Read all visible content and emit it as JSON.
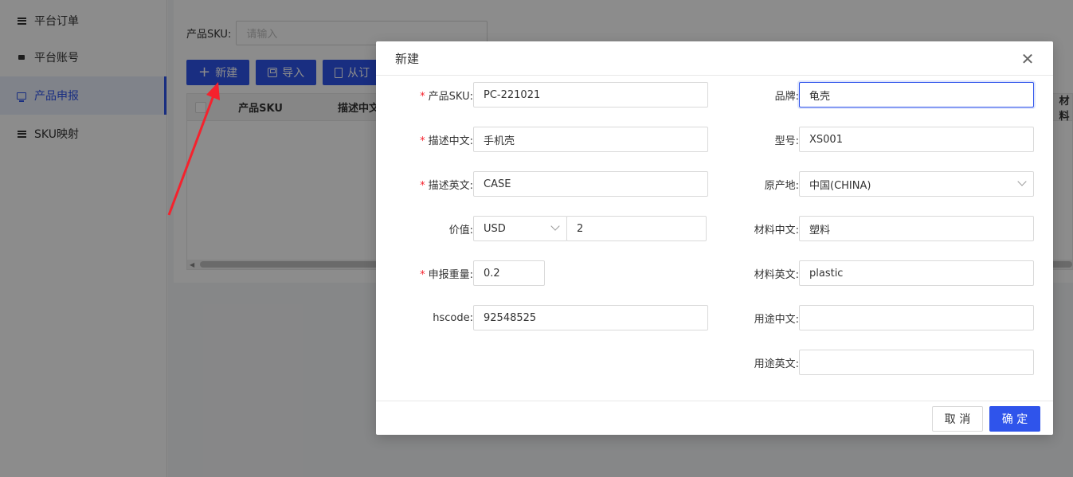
{
  "sidebar": {
    "items": [
      {
        "label": "平台订单",
        "icon": "menu-icon"
      },
      {
        "label": "平台账号",
        "icon": "card-icon"
      },
      {
        "label": "产品申报",
        "icon": "monitor-icon",
        "active": true
      },
      {
        "label": "SKU映射",
        "icon": "menu-icon"
      }
    ]
  },
  "search": {
    "label": "产品SKU:",
    "placeholder": "请输入"
  },
  "toolbar": {
    "new_label": "新建",
    "import_label": "导入",
    "from_label": "从订"
  },
  "table": {
    "columns": [
      "产品SKU",
      "描述中文"
    ],
    "right_edge_header": "材料"
  },
  "modal": {
    "title": "新建",
    "fields": {
      "sku": {
        "label": "产品SKU:",
        "value": "PC-221021",
        "required": true
      },
      "desc_cn": {
        "label": "描述中文:",
        "value": "手机壳",
        "required": true
      },
      "desc_en": {
        "label": "描述英文:",
        "value": "CASE",
        "required": true
      },
      "value": {
        "label": "价值:",
        "currency": "USD",
        "amount": "2"
      },
      "weight": {
        "label": "申报重量:",
        "value": "0.2",
        "required": true
      },
      "hscode": {
        "label": "hscode:",
        "value": "92548525"
      },
      "brand": {
        "label": "品牌:",
        "value": "龟壳"
      },
      "model": {
        "label": "型号:",
        "value": "XS001"
      },
      "origin": {
        "label": "原产地:",
        "value": "中国(CHINA)"
      },
      "material_cn": {
        "label": "材料中文:",
        "value": "塑料"
      },
      "material_en": {
        "label": "材料英文:",
        "value": "plastic"
      },
      "usage_cn": {
        "label": "用途中文:",
        "value": ""
      },
      "usage_en": {
        "label": "用途英文:",
        "value": ""
      }
    },
    "required_mark": "*",
    "cancel_label": "取 消",
    "ok_label": "确 定",
    "close_glyph": "✕"
  },
  "colors": {
    "primary": "#2f54eb",
    "annotation_arrow": "#f5222d"
  }
}
